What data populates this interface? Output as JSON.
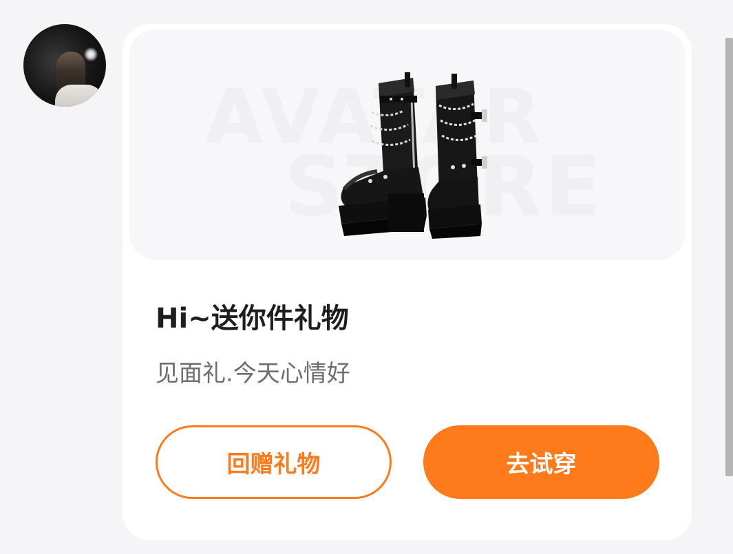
{
  "avatar": {
    "alt": "user avatar"
  },
  "gift_card": {
    "watermark_top": "AVATAR",
    "watermark_bottom": "STORE",
    "title": "Hi~送你件礼物",
    "subtitle": "见面礼.今天心情好",
    "buttons": {
      "return_gift": "回赠礼物",
      "try_on": "去试穿"
    }
  },
  "colors": {
    "accent": "#ff7a1a",
    "card_bg": "#ffffff",
    "page_bg": "#f5f5f7"
  },
  "icons": {
    "product": "platform-boots-icon"
  }
}
